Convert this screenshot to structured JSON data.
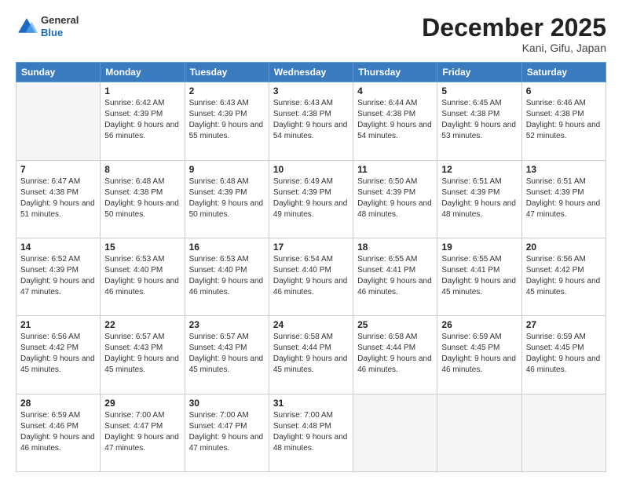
{
  "header": {
    "logo": {
      "general": "General",
      "blue": "Blue"
    },
    "title": "December 2025",
    "location": "Kani, Gifu, Japan"
  },
  "weekdays": [
    "Sunday",
    "Monday",
    "Tuesday",
    "Wednesday",
    "Thursday",
    "Friday",
    "Saturday"
  ],
  "weeks": [
    [
      {
        "day": "",
        "empty": true
      },
      {
        "day": "1",
        "sunrise": "6:42 AM",
        "sunset": "4:39 PM",
        "daylight": "9 hours and 56 minutes."
      },
      {
        "day": "2",
        "sunrise": "6:43 AM",
        "sunset": "4:39 PM",
        "daylight": "9 hours and 55 minutes."
      },
      {
        "day": "3",
        "sunrise": "6:43 AM",
        "sunset": "4:38 PM",
        "daylight": "9 hours and 54 minutes."
      },
      {
        "day": "4",
        "sunrise": "6:44 AM",
        "sunset": "4:38 PM",
        "daylight": "9 hours and 54 minutes."
      },
      {
        "day": "5",
        "sunrise": "6:45 AM",
        "sunset": "4:38 PM",
        "daylight": "9 hours and 53 minutes."
      },
      {
        "day": "6",
        "sunrise": "6:46 AM",
        "sunset": "4:38 PM",
        "daylight": "9 hours and 52 minutes."
      }
    ],
    [
      {
        "day": "7",
        "sunrise": "6:47 AM",
        "sunset": "4:38 PM",
        "daylight": "9 hours and 51 minutes."
      },
      {
        "day": "8",
        "sunrise": "6:48 AM",
        "sunset": "4:38 PM",
        "daylight": "9 hours and 50 minutes."
      },
      {
        "day": "9",
        "sunrise": "6:48 AM",
        "sunset": "4:39 PM",
        "daylight": "9 hours and 50 minutes."
      },
      {
        "day": "10",
        "sunrise": "6:49 AM",
        "sunset": "4:39 PM",
        "daylight": "9 hours and 49 minutes."
      },
      {
        "day": "11",
        "sunrise": "6:50 AM",
        "sunset": "4:39 PM",
        "daylight": "9 hours and 48 minutes."
      },
      {
        "day": "12",
        "sunrise": "6:51 AM",
        "sunset": "4:39 PM",
        "daylight": "9 hours and 48 minutes."
      },
      {
        "day": "13",
        "sunrise": "6:51 AM",
        "sunset": "4:39 PM",
        "daylight": "9 hours and 47 minutes."
      }
    ],
    [
      {
        "day": "14",
        "sunrise": "6:52 AM",
        "sunset": "4:39 PM",
        "daylight": "9 hours and 47 minutes."
      },
      {
        "day": "15",
        "sunrise": "6:53 AM",
        "sunset": "4:40 PM",
        "daylight": "9 hours and 46 minutes."
      },
      {
        "day": "16",
        "sunrise": "6:53 AM",
        "sunset": "4:40 PM",
        "daylight": "9 hours and 46 minutes."
      },
      {
        "day": "17",
        "sunrise": "6:54 AM",
        "sunset": "4:40 PM",
        "daylight": "9 hours and 46 minutes."
      },
      {
        "day": "18",
        "sunrise": "6:55 AM",
        "sunset": "4:41 PM",
        "daylight": "9 hours and 46 minutes."
      },
      {
        "day": "19",
        "sunrise": "6:55 AM",
        "sunset": "4:41 PM",
        "daylight": "9 hours and 45 minutes."
      },
      {
        "day": "20",
        "sunrise": "6:56 AM",
        "sunset": "4:42 PM",
        "daylight": "9 hours and 45 minutes."
      }
    ],
    [
      {
        "day": "21",
        "sunrise": "6:56 AM",
        "sunset": "4:42 PM",
        "daylight": "9 hours and 45 minutes."
      },
      {
        "day": "22",
        "sunrise": "6:57 AM",
        "sunset": "4:43 PM",
        "daylight": "9 hours and 45 minutes."
      },
      {
        "day": "23",
        "sunrise": "6:57 AM",
        "sunset": "4:43 PM",
        "daylight": "9 hours and 45 minutes."
      },
      {
        "day": "24",
        "sunrise": "6:58 AM",
        "sunset": "4:44 PM",
        "daylight": "9 hours and 45 minutes."
      },
      {
        "day": "25",
        "sunrise": "6:58 AM",
        "sunset": "4:44 PM",
        "daylight": "9 hours and 46 minutes."
      },
      {
        "day": "26",
        "sunrise": "6:59 AM",
        "sunset": "4:45 PM",
        "daylight": "9 hours and 46 minutes."
      },
      {
        "day": "27",
        "sunrise": "6:59 AM",
        "sunset": "4:45 PM",
        "daylight": "9 hours and 46 minutes."
      }
    ],
    [
      {
        "day": "28",
        "sunrise": "6:59 AM",
        "sunset": "4:46 PM",
        "daylight": "9 hours and 46 minutes."
      },
      {
        "day": "29",
        "sunrise": "7:00 AM",
        "sunset": "4:47 PM",
        "daylight": "9 hours and 47 minutes."
      },
      {
        "day": "30",
        "sunrise": "7:00 AM",
        "sunset": "4:47 PM",
        "daylight": "9 hours and 47 minutes."
      },
      {
        "day": "31",
        "sunrise": "7:00 AM",
        "sunset": "4:48 PM",
        "daylight": "9 hours and 48 minutes."
      },
      {
        "day": "",
        "empty": true
      },
      {
        "day": "",
        "empty": true
      },
      {
        "day": "",
        "empty": true
      }
    ]
  ]
}
